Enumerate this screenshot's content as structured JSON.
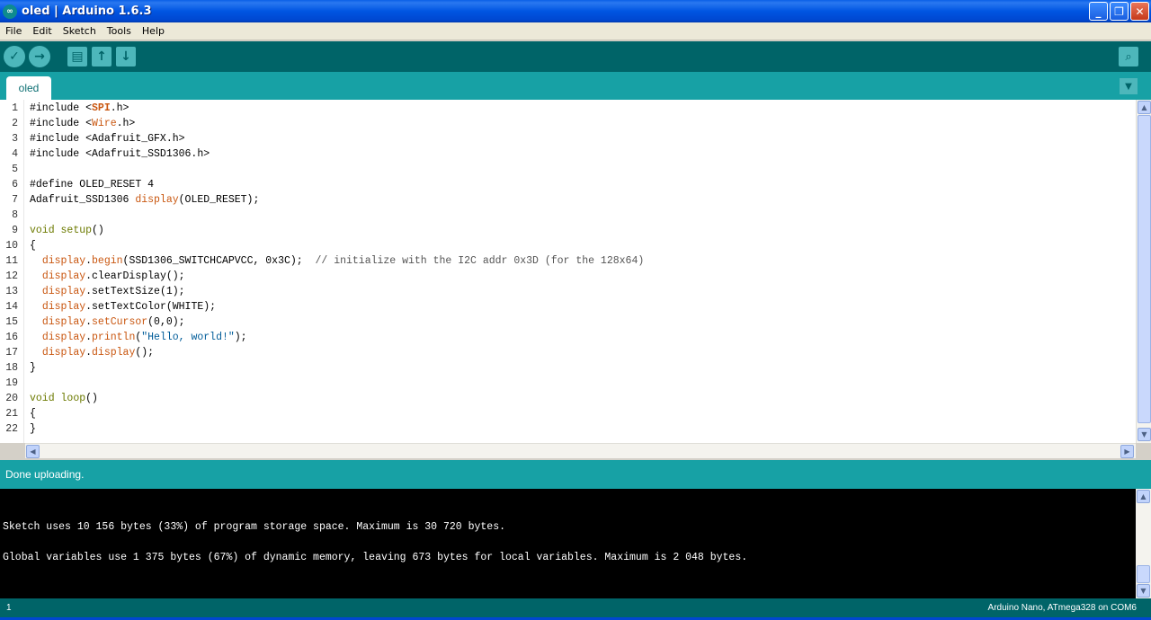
{
  "window": {
    "app_icon": "∞",
    "title": "oled | Arduino 1.6.3",
    "minimize_glyph": "_",
    "maximize_glyph": "❐",
    "close_glyph": "✕"
  },
  "menu": [
    "File",
    "Edit",
    "Sketch",
    "Tools",
    "Help"
  ],
  "toolbar": {
    "verify_icon": "✓",
    "upload_icon": "→",
    "new_icon": "▤",
    "open_icon": "↑",
    "save_icon": "↓",
    "serial_icon": "⌕"
  },
  "tab": {
    "label": "oled",
    "menu_glyph": "▼"
  },
  "code_lines": [
    [
      {
        "t": "#include <",
        "c": "pl"
      },
      {
        "t": "SPI",
        "c": "kw-b"
      },
      {
        "t": ".h>",
        "c": "pl"
      }
    ],
    [
      {
        "t": "#include <",
        "c": "pl"
      },
      {
        "t": "Wire",
        "c": "kw"
      },
      {
        "t": ".h>",
        "c": "pl"
      }
    ],
    [
      {
        "t": "#include <Adafruit_GFX.h>",
        "c": "pl"
      }
    ],
    [
      {
        "t": "#include <Adafruit_SSD1306.h>",
        "c": "pl"
      }
    ],
    [],
    [
      {
        "t": "#define OLED_RESET 4",
        "c": "pl"
      }
    ],
    [
      {
        "t": "Adafruit_SSD1306 ",
        "c": "pl"
      },
      {
        "t": "display",
        "c": "kw"
      },
      {
        "t": "(OLED_RESET);",
        "c": "pl"
      }
    ],
    [],
    [
      {
        "t": "void",
        "c": "type"
      },
      {
        "t": " ",
        "c": "pl"
      },
      {
        "t": "setup",
        "c": "type"
      },
      {
        "t": "()",
        "c": "pl"
      }
    ],
    [
      {
        "t": "{",
        "c": "pl"
      }
    ],
    [
      {
        "t": "  ",
        "c": "pl"
      },
      {
        "t": "display",
        "c": "kw"
      },
      {
        "t": ".",
        "c": "pl"
      },
      {
        "t": "begin",
        "c": "kw"
      },
      {
        "t": "(SSD1306_SWITCHCAPVCC, 0x3C);  ",
        "c": "pl"
      },
      {
        "t": "// initialize with the I2C addr 0x3D (for the 128x64)",
        "c": "cm"
      }
    ],
    [
      {
        "t": "  ",
        "c": "pl"
      },
      {
        "t": "display",
        "c": "kw"
      },
      {
        "t": ".clearDisplay();",
        "c": "pl"
      }
    ],
    [
      {
        "t": "  ",
        "c": "pl"
      },
      {
        "t": "display",
        "c": "kw"
      },
      {
        "t": ".setTextSize(1);",
        "c": "pl"
      }
    ],
    [
      {
        "t": "  ",
        "c": "pl"
      },
      {
        "t": "display",
        "c": "kw"
      },
      {
        "t": ".setTextColor(WHITE);",
        "c": "pl"
      }
    ],
    [
      {
        "t": "  ",
        "c": "pl"
      },
      {
        "t": "display",
        "c": "kw"
      },
      {
        "t": ".",
        "c": "pl"
      },
      {
        "t": "setCursor",
        "c": "kw"
      },
      {
        "t": "(0,0);",
        "c": "pl"
      }
    ],
    [
      {
        "t": "  ",
        "c": "pl"
      },
      {
        "t": "display",
        "c": "kw"
      },
      {
        "t": ".",
        "c": "pl"
      },
      {
        "t": "println",
        "c": "kw"
      },
      {
        "t": "(",
        "c": "pl"
      },
      {
        "t": "\"Hello, world!\"",
        "c": "str"
      },
      {
        "t": ");",
        "c": "pl"
      }
    ],
    [
      {
        "t": "  ",
        "c": "pl"
      },
      {
        "t": "display",
        "c": "kw"
      },
      {
        "t": ".",
        "c": "pl"
      },
      {
        "t": "display",
        "c": "kw"
      },
      {
        "t": "();",
        "c": "pl"
      }
    ],
    [
      {
        "t": "}",
        "c": "pl"
      }
    ],
    [],
    [
      {
        "t": "void",
        "c": "type"
      },
      {
        "t": " ",
        "c": "pl"
      },
      {
        "t": "loop",
        "c": "type"
      },
      {
        "t": "()",
        "c": "pl"
      }
    ],
    [
      {
        "t": "{",
        "c": "pl"
      }
    ],
    [
      {
        "t": "}",
        "c": "pl"
      }
    ]
  ],
  "line_numbers": [
    "1",
    "2",
    "3",
    "4",
    "5",
    "6",
    "7",
    "8",
    "9",
    "10",
    "11",
    "12",
    "13",
    "14",
    "15",
    "16",
    "17",
    "18",
    "19",
    "20",
    "21",
    "22"
  ],
  "status": {
    "message": "Done uploading."
  },
  "console_lines": [
    "Sketch uses 10 156 bytes (33%) of program storage space. Maximum is 30 720 bytes.",
    "Global variables use 1 375 bytes (67%) of dynamic memory, leaving 673 bytes for local variables. Maximum is 2 048 bytes."
  ],
  "bottom": {
    "line_number": "1",
    "board": "Arduino Nano, ATmega328 on COM6"
  },
  "scroll_glyphs": {
    "up": "▲",
    "down": "▼",
    "left": "◀",
    "right": "▶"
  }
}
